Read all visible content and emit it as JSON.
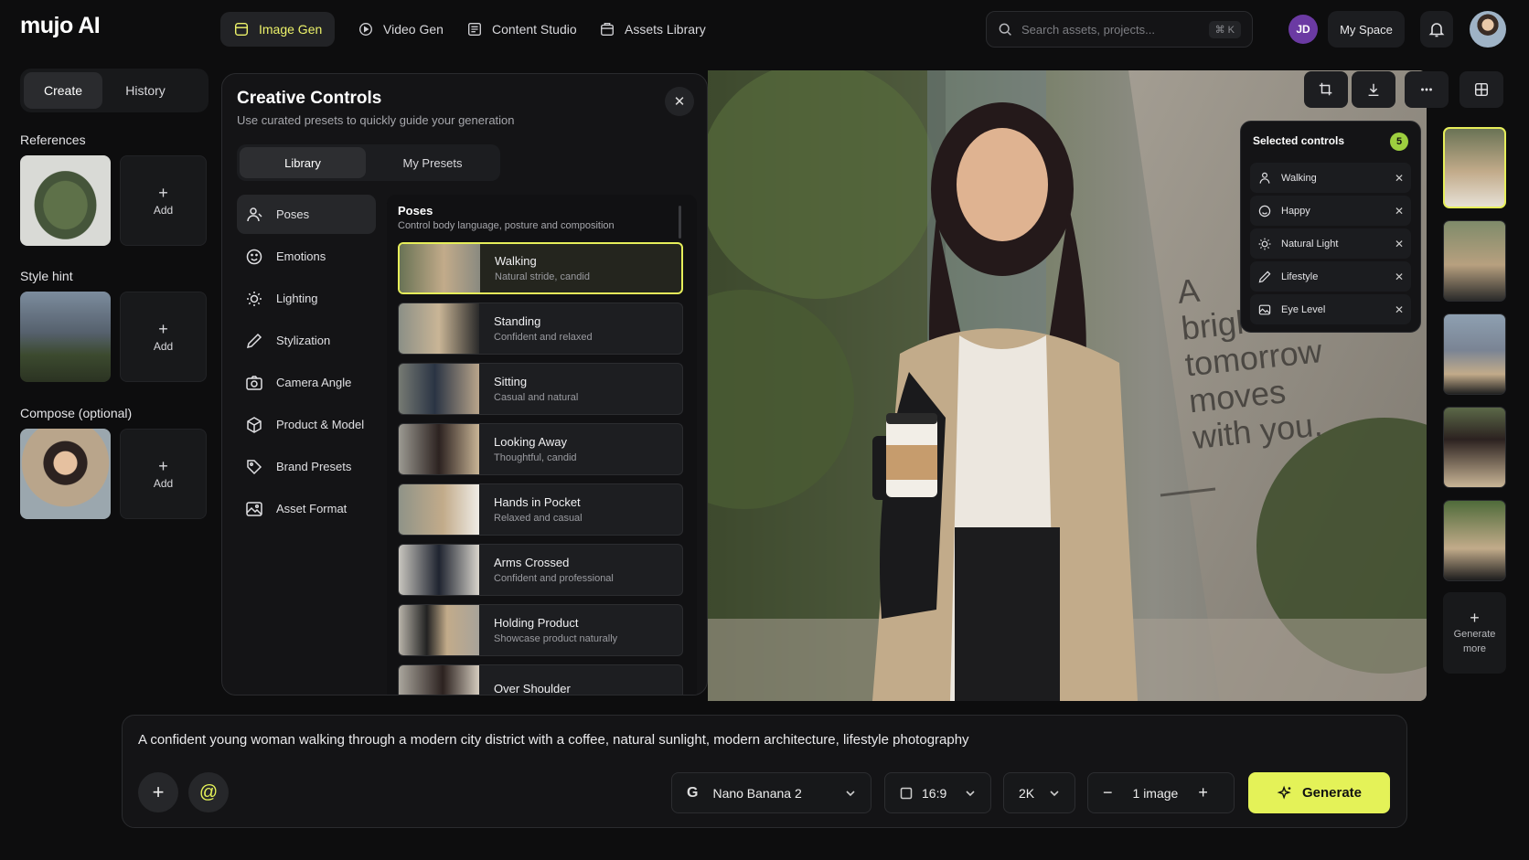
{
  "app": {
    "logo": "mujo AI"
  },
  "topnav": [
    {
      "label": "Image Gen",
      "icon": "image-icon",
      "active": true
    },
    {
      "label": "Video Gen",
      "icon": "play-icon"
    },
    {
      "label": "Content Studio",
      "icon": "studio-icon"
    },
    {
      "label": "Assets Library",
      "icon": "folder-icon"
    }
  ],
  "search": {
    "placeholder": "Search assets, projects...",
    "shortcut": "⌘ K"
  },
  "user": {
    "initials": "JD",
    "space_label": "My Space"
  },
  "left": {
    "tabs": [
      "Create",
      "History"
    ],
    "references_label": "References",
    "style_hint_label": "Style hint",
    "compose_label": "Compose (optional)",
    "add_label": "Add"
  },
  "creative_controls": {
    "title": "Creative Controls",
    "subtitle": "Use curated presets to quickly guide your generation",
    "tabs": [
      "Library",
      "My Presets"
    ],
    "categories": [
      {
        "label": "Poses",
        "icon": "person-icon"
      },
      {
        "label": "Emotions",
        "icon": "smile-icon"
      },
      {
        "label": "Lighting",
        "icon": "sun-icon"
      },
      {
        "label": "Stylization",
        "icon": "pencil-icon"
      },
      {
        "label": "Camera Angle",
        "icon": "camera-icon"
      },
      {
        "label": "Product & Model",
        "icon": "cube-icon"
      },
      {
        "label": "Brand Presets",
        "icon": "tag-icon"
      },
      {
        "label": "Asset Format",
        "icon": "image-frame-icon"
      }
    ],
    "section_title": "Poses",
    "section_subtitle": "Control body language, posture and composition",
    "poses": [
      {
        "name": "Walking",
        "desc": "Natural stride, candid"
      },
      {
        "name": "Standing",
        "desc": "Confident and relaxed"
      },
      {
        "name": "Sitting",
        "desc": "Casual and natural"
      },
      {
        "name": "Looking Away",
        "desc": "Thoughtful, candid"
      },
      {
        "name": "Hands in Pocket",
        "desc": "Relaxed and casual"
      },
      {
        "name": "Arms Crossed",
        "desc": "Confident and professional"
      },
      {
        "name": "Holding Product",
        "desc": "Showcase product naturally"
      },
      {
        "name": "Over Shoulder",
        "desc": ""
      }
    ]
  },
  "canvas": {
    "wall_text": "A\nbrighter\ntomorrow\nmoves\nwith you."
  },
  "selected_controls": {
    "title": "Selected controls",
    "count": "5",
    "items": [
      {
        "label": "Walking",
        "icon": "person-icon"
      },
      {
        "label": "Happy",
        "icon": "smile-icon"
      },
      {
        "label": "Natural Light",
        "icon": "sun-icon"
      },
      {
        "label": "Lifestyle",
        "icon": "pencil-icon"
      },
      {
        "label": "Eye Level",
        "icon": "image-frame-icon"
      }
    ]
  },
  "strip": {
    "generate_more": "Generate\nmore"
  },
  "prompt": {
    "text": "A confident young woman walking through a modern city district with a coffee, natural sunlight, modern architecture, lifestyle photography",
    "model": "Nano Banana 2",
    "aspect": "16:9",
    "resolution": "2K",
    "count": "1 image",
    "generate": "Generate"
  },
  "colors": {
    "accent": "#e4f258",
    "badge": "#9dcf3f",
    "avatar": "#6b3aa3"
  }
}
